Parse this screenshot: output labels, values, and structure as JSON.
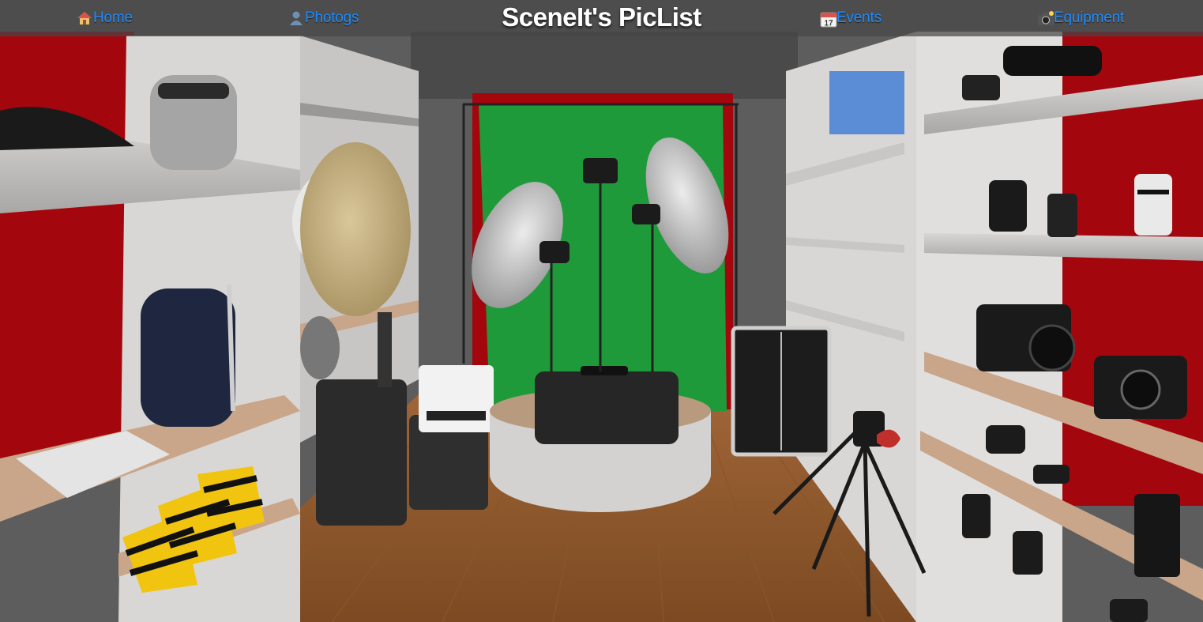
{
  "header": {
    "title": "SceneIt's PicList",
    "nav": [
      {
        "label": "Home",
        "icon": "house-icon"
      },
      {
        "label": "Photogs",
        "icon": "person-icon"
      },
      {
        "label": "Events",
        "icon": "calendar-icon"
      },
      {
        "label": "Equipment",
        "icon": "camera-icon"
      }
    ],
    "calendar_day": "17",
    "link_color": "#1e8cff"
  }
}
